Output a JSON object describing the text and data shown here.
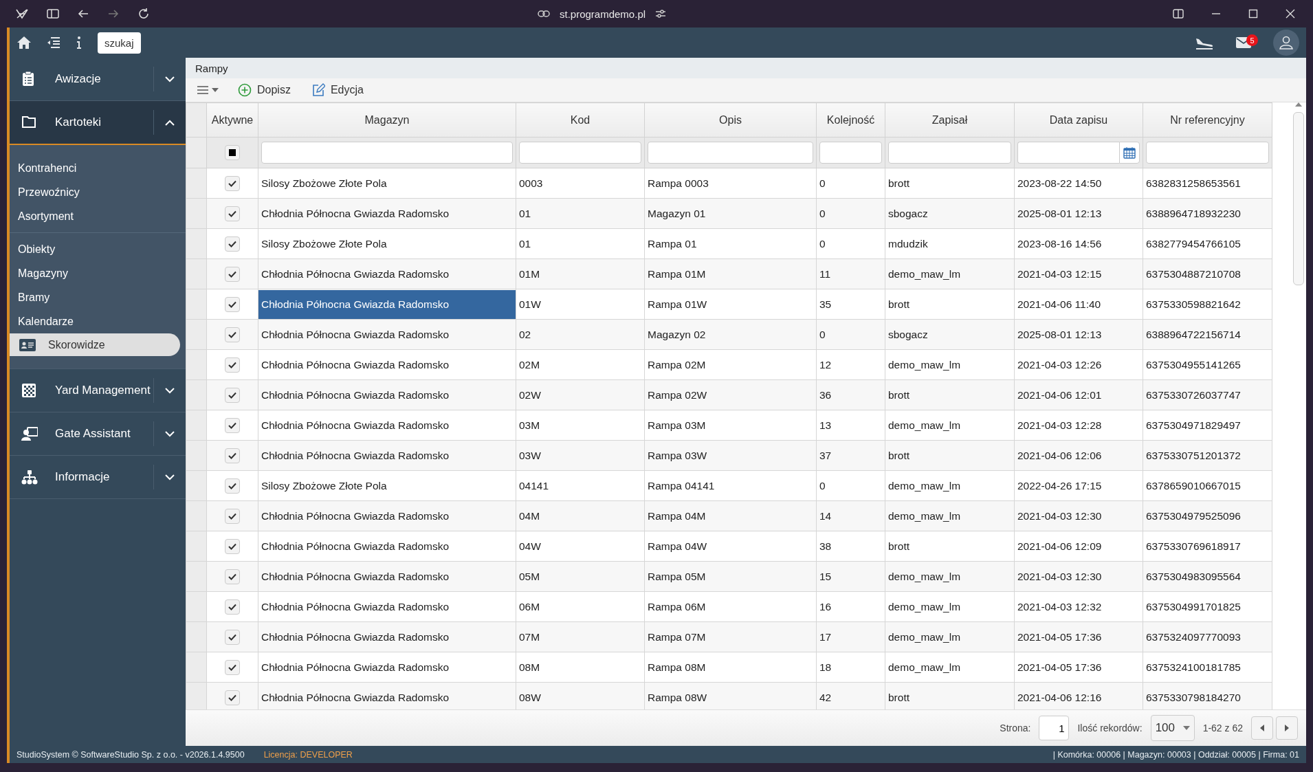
{
  "browser": {
    "url": "st.programdemo.pl"
  },
  "header": {
    "search_button": "szukaj",
    "mail_badge": "5"
  },
  "sidebar": {
    "sections": [
      {
        "label": "Awizacje",
        "expanded": false
      },
      {
        "label": "Kartoteki",
        "expanded": true,
        "groups": [
          [
            {
              "label": "Kontrahenci",
              "selected": false
            },
            {
              "label": "Przewoźnicy",
              "selected": false
            },
            {
              "label": "Asortyment",
              "selected": false
            }
          ],
          [
            {
              "label": "Obiekty",
              "selected": false
            },
            {
              "label": "Magazyny",
              "selected": false
            },
            {
              "label": "Bramy",
              "selected": false
            },
            {
              "label": "Kalendarze",
              "selected": false
            },
            {
              "label": "Skorowidze",
              "selected": true
            }
          ]
        ]
      },
      {
        "label": "Yard Management",
        "expanded": false
      },
      {
        "label": "Gate Assistant",
        "expanded": false
      },
      {
        "label": "Informacje",
        "expanded": false
      }
    ]
  },
  "breadcrumb": "Rampy",
  "toolbar": {
    "add": "Dopisz",
    "edit": "Edycja"
  },
  "table": {
    "checkbox_column": {
      "label": "Aktywne",
      "filter_indeterminate": true
    },
    "columns": [
      {
        "label": "Magazyn",
        "kind": "text"
      },
      {
        "label": "Kod",
        "kind": "text"
      },
      {
        "label": "Opis",
        "kind": "text"
      },
      {
        "label": "Kolejność",
        "kind": "text"
      },
      {
        "label": "Zapisał",
        "kind": "text"
      },
      {
        "label": "Data zapisu",
        "kind": "date"
      },
      {
        "label": "Nr referencyjny",
        "kind": "text"
      }
    ],
    "rows": [
      {
        "active": true,
        "selected": false,
        "cells": [
          "Silosy Zbożowe Złote Pola",
          "0003",
          "Rampa 0003",
          "0",
          "brott",
          "2023-08-22 14:50",
          "6382831258653561"
        ]
      },
      {
        "active": true,
        "selected": false,
        "cells": [
          "Chłodnia Północna Gwiazda Radomsko",
          "01",
          "Magazyn 01",
          "0",
          "sbogacz",
          "2025-08-01 12:13",
          "6388964718932230"
        ]
      },
      {
        "active": true,
        "selected": false,
        "cells": [
          "Silosy Zbożowe Złote Pola",
          "01",
          "Rampa 01",
          "0",
          "mdudzik",
          "2023-08-16 14:56",
          "6382779454766105"
        ]
      },
      {
        "active": true,
        "selected": false,
        "cells": [
          "Chłodnia Północna Gwiazda Radomsko",
          "01M",
          "Rampa 01M",
          "11",
          "demo_maw_lm",
          "2021-04-03 12:15",
          "6375304887210708"
        ]
      },
      {
        "active": true,
        "selected": true,
        "cells": [
          "Chłodnia Północna Gwiazda Radomsko",
          "01W",
          "Rampa 01W",
          "35",
          "brott",
          "2021-04-06 11:40",
          "6375330598821642"
        ]
      },
      {
        "active": true,
        "selected": false,
        "cells": [
          "Chłodnia Północna Gwiazda Radomsko",
          "02",
          "Magazyn 02",
          "0",
          "sbogacz",
          "2025-08-01 12:13",
          "6388964722156714"
        ]
      },
      {
        "active": true,
        "selected": false,
        "cells": [
          "Chłodnia Północna Gwiazda Radomsko",
          "02M",
          "Rampa 02M",
          "12",
          "demo_maw_lm",
          "2021-04-03 12:26",
          "6375304955141265"
        ]
      },
      {
        "active": true,
        "selected": false,
        "cells": [
          "Chłodnia Północna Gwiazda Radomsko",
          "02W",
          "Rampa 02W",
          "36",
          "brott",
          "2021-04-06 12:01",
          "6375330726037747"
        ]
      },
      {
        "active": true,
        "selected": false,
        "cells": [
          "Chłodnia Północna Gwiazda Radomsko",
          "03M",
          "Rampa 03M",
          "13",
          "demo_maw_lm",
          "2021-04-03 12:28",
          "6375304971829497"
        ]
      },
      {
        "active": true,
        "selected": false,
        "cells": [
          "Chłodnia Północna Gwiazda Radomsko",
          "03W",
          "Rampa 03W",
          "37",
          "brott",
          "2021-04-06 12:06",
          "6375330751201372"
        ]
      },
      {
        "active": true,
        "selected": false,
        "cells": [
          "Silosy Zbożowe Złote Pola",
          "04141",
          "Rampa 04141",
          "0",
          "demo_maw_lm",
          "2022-04-26 17:15",
          "6378659010667015"
        ]
      },
      {
        "active": true,
        "selected": false,
        "cells": [
          "Chłodnia Północna Gwiazda Radomsko",
          "04M",
          "Rampa 04M",
          "14",
          "demo_maw_lm",
          "2021-04-03 12:30",
          "6375304979525096"
        ]
      },
      {
        "active": true,
        "selected": false,
        "cells": [
          "Chłodnia Północna Gwiazda Radomsko",
          "04W",
          "Rampa 04W",
          "38",
          "brott",
          "2021-04-06 12:09",
          "6375330769618917"
        ]
      },
      {
        "active": true,
        "selected": false,
        "cells": [
          "Chłodnia Północna Gwiazda Radomsko",
          "05M",
          "Rampa 05M",
          "15",
          "demo_maw_lm",
          "2021-04-03 12:30",
          "6375304983095564"
        ]
      },
      {
        "active": true,
        "selected": false,
        "cells": [
          "Chłodnia Północna Gwiazda Radomsko",
          "06M",
          "Rampa 06M",
          "16",
          "demo_maw_lm",
          "2021-04-03 12:32",
          "6375304991701825"
        ]
      },
      {
        "active": true,
        "selected": false,
        "cells": [
          "Chłodnia Północna Gwiazda Radomsko",
          "07M",
          "Rampa 07M",
          "17",
          "demo_maw_lm",
          "2021-04-05 17:36",
          "6375324097770093"
        ]
      },
      {
        "active": true,
        "selected": false,
        "cells": [
          "Chłodnia Północna Gwiazda Radomsko",
          "08M",
          "Rampa 08M",
          "18",
          "demo_maw_lm",
          "2021-04-05 17:36",
          "6375324100181785"
        ]
      },
      {
        "active": true,
        "selected": false,
        "cells": [
          "Chłodnia Północna Gwiazda Radomsko",
          "08W",
          "Rampa 08W",
          "42",
          "brott",
          "2021-04-06 12:16",
          "6375330798184270"
        ]
      }
    ]
  },
  "pager": {
    "page_label": "Strona:",
    "page": "1",
    "size_label": "Ilość rekordów:",
    "size": "100",
    "range": "1-62 z 62"
  },
  "status_bar": {
    "copyright": "StudioSystem © SoftwareStudio Sp. z o.o. - v2026.1.4.9500",
    "license": "Licencja: DEVELOPER",
    "context": "| Komórka: 00006 | Magazyn: 00003 | Oddział: 00005 | Firma: 01"
  }
}
